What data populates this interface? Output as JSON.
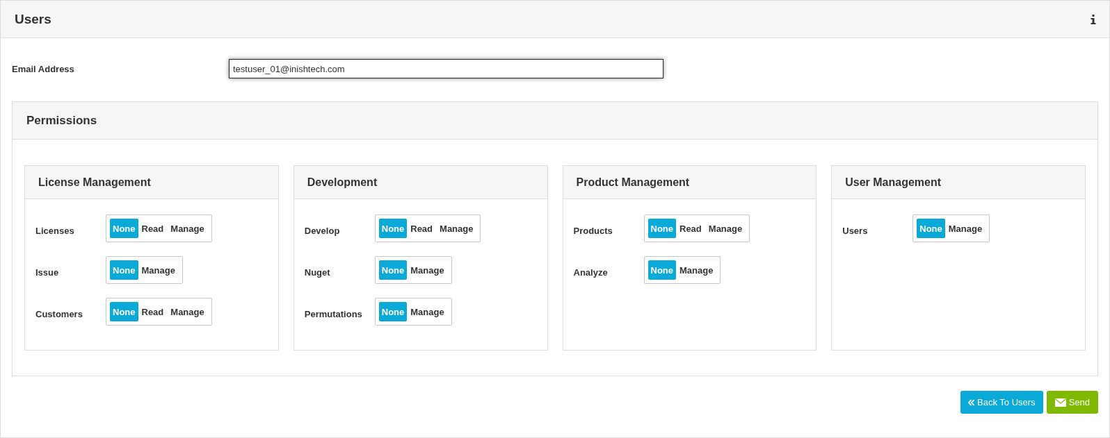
{
  "page": {
    "title": "Users"
  },
  "email": {
    "label": "Email Address",
    "value": "testuser_01@inishtech.com",
    "focused": true
  },
  "permissions": {
    "title": "Permissions",
    "groups": [
      {
        "title": "License Management",
        "items": [
          {
            "label": "Licenses",
            "options": [
              {
                "label": "None",
                "selected": true
              },
              {
                "label": "Read",
                "selected": false
              },
              {
                "label": "Manage",
                "selected": false
              }
            ]
          },
          {
            "label": "Issue",
            "options": [
              {
                "label": "None",
                "selected": true
              },
              {
                "label": "Manage",
                "selected": false
              }
            ]
          },
          {
            "label": "Customers",
            "options": [
              {
                "label": "None",
                "selected": true
              },
              {
                "label": "Read",
                "selected": false
              },
              {
                "label": "Manage",
                "selected": false
              }
            ]
          }
        ]
      },
      {
        "title": "Development",
        "items": [
          {
            "label": "Develop",
            "options": [
              {
                "label": "None",
                "selected": true
              },
              {
                "label": "Read",
                "selected": false
              },
              {
                "label": "Manage",
                "selected": false
              }
            ]
          },
          {
            "label": "Nuget",
            "options": [
              {
                "label": "None",
                "selected": true
              },
              {
                "label": "Manage",
                "selected": false
              }
            ]
          },
          {
            "label": "Permutations",
            "options": [
              {
                "label": "None",
                "selected": true
              },
              {
                "label": "Manage",
                "selected": false
              }
            ]
          }
        ]
      },
      {
        "title": "Product Management",
        "items": [
          {
            "label": "Products",
            "options": [
              {
                "label": "None",
                "selected": true
              },
              {
                "label": "Read",
                "selected": false
              },
              {
                "label": "Manage",
                "selected": false
              }
            ]
          },
          {
            "label": "Analyze",
            "options": [
              {
                "label": "None",
                "selected": true
              },
              {
                "label": "Manage",
                "selected": false
              }
            ]
          }
        ]
      },
      {
        "title": "User Management",
        "items": [
          {
            "label": "Users",
            "options": [
              {
                "label": "None",
                "selected": true
              },
              {
                "label": "Manage",
                "selected": false
              }
            ]
          }
        ]
      }
    ]
  },
  "buttons": [
    {
      "kind": "back",
      "label": "Back To Users"
    },
    {
      "kind": "send",
      "label": "Send"
    }
  ]
}
